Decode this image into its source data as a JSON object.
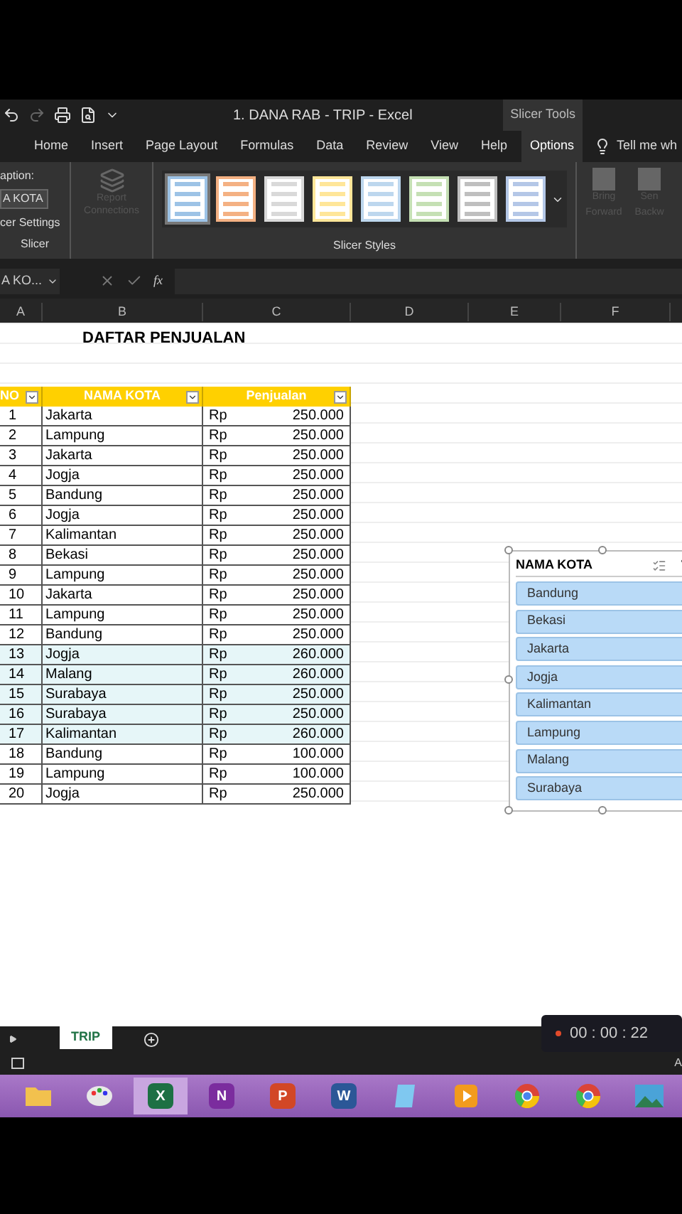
{
  "title_bar": {
    "title": "1. DANA RAB - TRIP  -  Excel",
    "context_label": "Slicer Tools"
  },
  "tabs": [
    {
      "label": "Home",
      "selected": false
    },
    {
      "label": "Insert",
      "selected": false
    },
    {
      "label": "Page Layout",
      "selected": false
    },
    {
      "label": "Formulas",
      "selected": false
    },
    {
      "label": "Data",
      "selected": false
    },
    {
      "label": "Review",
      "selected": false
    },
    {
      "label": "View",
      "selected": false
    },
    {
      "label": "Help",
      "selected": false
    },
    {
      "label": "Options",
      "selected": true
    }
  ],
  "tell_me": "Tell me wh",
  "ribbon": {
    "caption_label": "aption:",
    "caption_value": "A KOTA",
    "settings": "cer Settings",
    "slicer_group": "Slicer",
    "report_connections": "Report Connections",
    "styles_group": "Slicer Styles",
    "styles": [
      {
        "color": "#9dc3e6",
        "selected": true
      },
      {
        "color": "#f4b183",
        "selected": false
      },
      {
        "color": "#d9d9d9",
        "selected": false
      },
      {
        "color": "#ffe699",
        "selected": false
      },
      {
        "color": "#bdd7ee",
        "selected": false
      },
      {
        "color": "#c5e0b4",
        "selected": false
      },
      {
        "color": "#bfbfbf",
        "selected": false
      },
      {
        "color": "#b4c7e7",
        "selected": false
      }
    ],
    "bring_forward": "Bring Forward",
    "send_backward": "Sen Backw"
  },
  "formula_bar": {
    "name_box": "A KO...",
    "fx": "fx"
  },
  "columns": [
    "A",
    "B",
    "C",
    "D",
    "E",
    "F"
  ],
  "sheet_title": "DAFTAR PENJUALAN",
  "table": {
    "columns": [
      "NO",
      "NAMA KOTA",
      "Penjualan"
    ],
    "rows": [
      {
        "no": "1",
        "city": "Jakarta",
        "currency": "Rp",
        "amount": "250.000",
        "highlighted": false
      },
      {
        "no": "2",
        "city": "Lampung",
        "currency": "Rp",
        "amount": "250.000",
        "highlighted": false
      },
      {
        "no": "3",
        "city": "Jakarta",
        "currency": "Rp",
        "amount": "250.000",
        "highlighted": false
      },
      {
        "no": "4",
        "city": "Jogja",
        "currency": "Rp",
        "amount": "250.000",
        "highlighted": false
      },
      {
        "no": "5",
        "city": "Bandung",
        "currency": "Rp",
        "amount": "250.000",
        "highlighted": false
      },
      {
        "no": "6",
        "city": "Jogja",
        "currency": "Rp",
        "amount": "250.000",
        "highlighted": false
      },
      {
        "no": "7",
        "city": "Kalimantan",
        "currency": "Rp",
        "amount": "250.000",
        "highlighted": false
      },
      {
        "no": "8",
        "city": "Bekasi",
        "currency": "Rp",
        "amount": "250.000",
        "highlighted": false
      },
      {
        "no": "9",
        "city": "Lampung",
        "currency": "Rp",
        "amount": "250.000",
        "highlighted": false
      },
      {
        "no": "10",
        "city": "Jakarta",
        "currency": "Rp",
        "amount": "250.000",
        "highlighted": false
      },
      {
        "no": "11",
        "city": "Lampung",
        "currency": "Rp",
        "amount": "250.000",
        "highlighted": false
      },
      {
        "no": "12",
        "city": "Bandung",
        "currency": "Rp",
        "amount": "250.000",
        "highlighted": false
      },
      {
        "no": "13",
        "city": "Jogja",
        "currency": "Rp",
        "amount": "260.000",
        "highlighted": true
      },
      {
        "no": "14",
        "city": "Malang",
        "currency": "Rp",
        "amount": "260.000",
        "highlighted": true
      },
      {
        "no": "15",
        "city": "Surabaya",
        "currency": "Rp",
        "amount": "250.000",
        "highlighted": true
      },
      {
        "no": "16",
        "city": "Surabaya",
        "currency": "Rp",
        "amount": "250.000",
        "highlighted": true
      },
      {
        "no": "17",
        "city": "Kalimantan",
        "currency": "Rp",
        "amount": "260.000",
        "highlighted": true
      },
      {
        "no": "18",
        "city": "Bandung",
        "currency": "Rp",
        "amount": "100.000",
        "highlighted": false
      },
      {
        "no": "19",
        "city": "Lampung",
        "currency": "Rp",
        "amount": "100.000",
        "highlighted": false
      },
      {
        "no": "20",
        "city": "Jogja",
        "currency": "Rp",
        "amount": "250.000",
        "highlighted": false
      }
    ]
  },
  "slicer": {
    "title": "NAMA KOTA",
    "items": [
      {
        "label": "Bandung",
        "selected": true
      },
      {
        "label": "Bekasi",
        "selected": true
      },
      {
        "label": "Jakarta",
        "selected": true
      },
      {
        "label": "Jogja",
        "selected": true
      },
      {
        "label": "Kalimantan",
        "selected": true
      },
      {
        "label": "Lampung",
        "selected": true
      },
      {
        "label": "Malang",
        "selected": true
      },
      {
        "label": "Surabaya",
        "selected": true
      }
    ]
  },
  "sheet_tabs": [
    {
      "label": "TRIP",
      "selected": true
    }
  ],
  "status_bar": {
    "text": "A"
  },
  "recorder": {
    "time": "00 : 00 : 22"
  },
  "taskbar": [
    {
      "kind": "folder",
      "color": "#f2c14e",
      "active": false
    },
    {
      "kind": "palette",
      "color": "#e8e8e8",
      "active": false
    },
    {
      "kind": "doc",
      "letter": "X",
      "color": "#1d7044",
      "active": true
    },
    {
      "kind": "doc",
      "letter": "N",
      "color": "#7b2c9e",
      "active": false
    },
    {
      "kind": "doc",
      "letter": "P",
      "color": "#d24726",
      "active": false
    },
    {
      "kind": "doc",
      "letter": "W",
      "color": "#2b5797",
      "active": false
    },
    {
      "kind": "note",
      "color": "#7fc8f0",
      "active": false
    },
    {
      "kind": "media",
      "color": "#f29b1d",
      "active": false
    },
    {
      "kind": "browser",
      "color": "#db4437",
      "active": false
    },
    {
      "kind": "browser",
      "color": "#db4437",
      "active": false
    },
    {
      "kind": "photo",
      "color": "#4aa3d8",
      "active": false
    }
  ]
}
